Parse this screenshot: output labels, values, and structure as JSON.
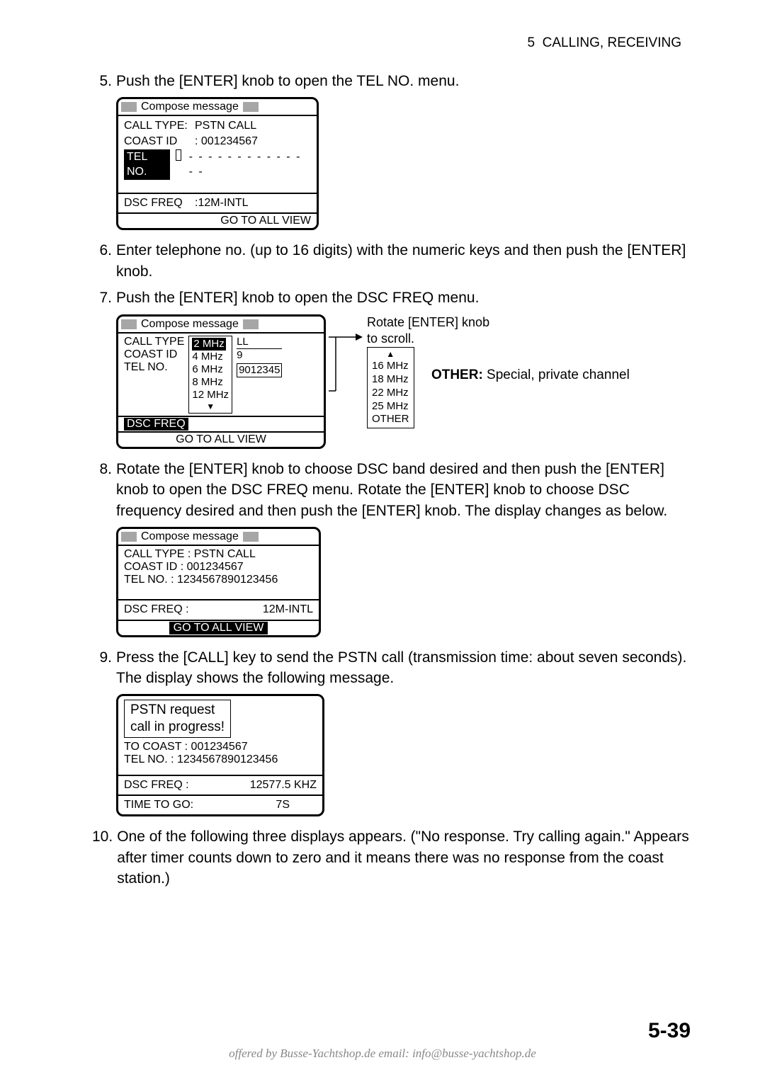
{
  "header": {
    "chapter": "5",
    "title": "CALLING, RECEIVING"
  },
  "steps": {
    "s5": {
      "num": "5.",
      "text": "Push the [ENTER] knob to open the TEL NO. menu."
    },
    "s6": {
      "num": "6.",
      "text": "Enter telephone no. (up to 16 digits) with the numeric keys and then push the [ENTER] knob."
    },
    "s7": {
      "num": "7.",
      "text": "Push the [ENTER] knob to open the DSC FREQ menu."
    },
    "s8": {
      "num": "8.",
      "text": "Rotate the [ENTER] knob to choose DSC band desired and then push the [ENTER] knob to open the DSC FREQ menu. Rotate the [ENTER] knob to choose DSC frequency desired and then push the [ENTER] knob. The display changes as below."
    },
    "s9": {
      "num": "9.",
      "text": "Press the [CALL] key to send the PSTN call (transmission time: about seven seconds). The display shows the following message."
    },
    "s10": {
      "num": "10.",
      "text": "One of the following three displays appears. (\"No response. Try calling again.\" Appears after timer counts down to zero and it means there was no response from the coast station.)"
    }
  },
  "lcd1": {
    "title": "Compose message",
    "call_type_label": "CALL TYPE:",
    "call_type_val": "PSTN CALL",
    "coast_label": "COAST ID",
    "coast_val": ": 001234567",
    "telno": "TEL NO.",
    "dashes": "- - - - - - - - - - - - - -",
    "dsc_label": "DSC FREQ",
    "dsc_val": ":12M-INTL",
    "footer": "GO TO ALL VIEW"
  },
  "lcd2": {
    "title": "Compose message",
    "labels": {
      "call": "CALL TYPE",
      "coast": "COAST ID",
      "tel": "TEL NO."
    },
    "opt_sel": "2 MHz",
    "opts": [
      "4 MHz",
      "6 MHz",
      "8 MHz",
      "12 MHz"
    ],
    "frag1": "LL",
    "frag2": "9",
    "frag3": "9012345",
    "dsc": "DSC FREQ",
    "footer": "GO TO ALL VIEW"
  },
  "scroll_hint": {
    "l1": "Rotate [ENTER] knob",
    "l2": "to scroll."
  },
  "scroll_opts": [
    "16 MHz",
    "18 MHz",
    "22 MHz",
    "25 MHz",
    "OTHER"
  ],
  "other_note": {
    "bold": "OTHER:",
    "rest": " Special, private channel"
  },
  "lcd3": {
    "title": "Compose message",
    "r1": "CALL TYPE  : PSTN CALL",
    "r2": "COAST ID   : 001234567",
    "r3": "TEL NO.   : 1234567890123456",
    "dsc": "DSC FREQ  :",
    "dsc_v": "12M-INTL",
    "footer": "GO TO ALL VIEW"
  },
  "lcd4": {
    "t1": "PSTN request",
    "t2": "call in progress!",
    "r1": "TO COAST  : 001234567",
    "r2": "TEL NO.      : 1234567890123456",
    "dsc": "DSC FREQ  :",
    "dsc_v": "12577.5 KHZ",
    "time_l": "TIME TO GO:",
    "time_v": "7S"
  },
  "pagenum": "5-39",
  "footer_offered": "offered by Busse-Yachtshop.de      email: info@busse-yachtshop.de"
}
